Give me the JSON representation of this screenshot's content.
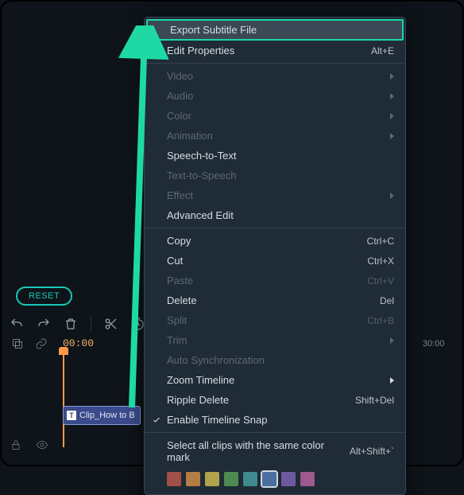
{
  "reset_label": "RESET",
  "timecode": "00:00",
  "ruler_mark": "30:00",
  "clip_label": "Clip_How to B",
  "caption": "Export Subtitle File",
  "menu": {
    "export_subtitle": "Export Subtitle File",
    "edit_properties": "Edit Properties",
    "edit_properties_sc": "Alt+E",
    "video": "Video",
    "audio": "Audio",
    "color": "Color",
    "animation": "Animation",
    "speech_to_text": "Speech-to-Text",
    "text_to_speech": "Text-to-Speech",
    "effect": "Effect",
    "advanced_edit": "Advanced Edit",
    "copy": "Copy",
    "copy_sc": "Ctrl+C",
    "cut": "Cut",
    "cut_sc": "Ctrl+X",
    "paste": "Paste",
    "paste_sc": "Ctrl+V",
    "delete": "Delete",
    "delete_sc": "Del",
    "split": "Split",
    "split_sc": "Ctrl+B",
    "trim": "Trim",
    "auto_sync": "Auto Synchronization",
    "zoom_timeline": "Zoom Timeline",
    "ripple_delete": "Ripple Delete",
    "ripple_delete_sc": "Shift+Del",
    "enable_snap": "Enable Timeline Snap",
    "select_color": "Select all clips with the same color mark",
    "select_color_sc": "Alt+Shift+`"
  },
  "swatches": [
    "#a24f4a",
    "#b37d45",
    "#b1a34a",
    "#4f8a52",
    "#3f8a8e",
    "#4b6fa0",
    "#6f5aa0",
    "#9e5a8f"
  ],
  "selected_swatch": 5
}
